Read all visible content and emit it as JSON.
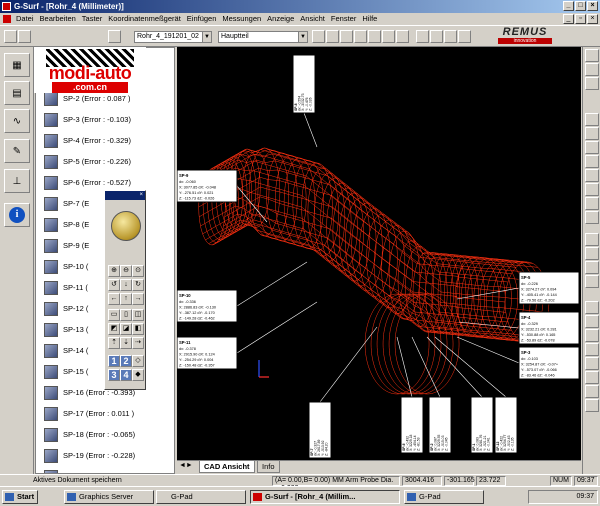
{
  "window": {
    "title": "G-Surf - [Rohr_4 (Millimeter)]"
  },
  "menu": [
    "Datei",
    "Bearbeiten",
    "Taster",
    "Koordinatenmeßgerät",
    "Einfügen",
    "Messungen",
    "Anzeige",
    "Ansicht",
    "Fenster",
    "Hilfe"
  ],
  "toolbar": {
    "file_combo": "Rohr_4_191201_02",
    "part_combo": "Hauptteil"
  },
  "brand": {
    "name": "REMUS",
    "tagline": "innovation"
  },
  "watermark": {
    "line1": "modi-auto",
    "line2": ".com.cn"
  },
  "tree": {
    "items": [
      "SP-1 (Error : 0.083 )",
      "SP-2 (Error : 0.087 )",
      "SP-3 (Error : -0.103)",
      "SP-4 (Error : -0.329)",
      "SP-5 (Error : -0.226)",
      "SP-6 (Error : -0.527)",
      "SP-7 (E",
      "SP-8 (E",
      "SP-9 (E",
      "SP-10 (",
      "SP-11 (",
      "SP-12 (",
      "SP-13 (",
      "SP-14 (",
      "SP-15 (",
      "SP-16 (Error : -0.393)",
      "SP-17 (Error : 0.011 )",
      "SP-18 (Error : -0.065)",
      "SP-19 (Error : -0.228)",
      "SP-20 (Error : -0.331)"
    ]
  },
  "palette": {
    "numbers": [
      "1",
      "2",
      "3",
      "4"
    ]
  },
  "viewport": {
    "callouts": [
      {
        "title": "SP-5",
        "lines": [
          "dx: -0.226",
          "X: 3274.27 dY: 0.094",
          "Y: -405.41 dY: -0.144",
          "Z: -79.56 dZ: -0.202"
        ]
      },
      {
        "title": "SP-4",
        "lines": [
          "dx: -0.329",
          "X: 3232.21 dX: 0.281",
          "Y: -530.88 dY: 0.165",
          "Z: -53.89 dZ: -0.078"
        ]
      },
      {
        "title": "SP-3",
        "lines": [
          "dx: -0.103",
          "X: 3254.87 dX: -0.07+",
          "Y: -573.07 dY: -0.066",
          "Z: -83.46 dZ: -0.046"
        ]
      },
      {
        "title": "SP-9",
        "lines": [
          "dx: -0.060",
          "X: 3077.85 dX: -0.048",
          "Y: -276.51 dY: 0.021",
          "Z: -115.73 dZ: -0.026"
        ]
      },
      {
        "title": "SP-10",
        "lines": [
          "dx: -0.336",
          "X: 2886.83 dX: -0.130",
          "Y: -387.12 dY: -0.170",
          "Z: -149.28 dZ: -0.462"
        ]
      },
      {
        "title": "SP-11",
        "lines": [
          "dx: -0.378",
          "X: 2915.90 dX: 0.124",
          "Y: -254.29 dY: 0.004",
          "Z: -150.48 dZ: -0.357"
        ]
      }
    ],
    "vertical_callouts": [
      {
        "title": "SP-8",
        "lines": [
          "dx: -0.554",
          "X: -3032.73",
          "Y: -0.476",
          "Z: -0.026"
        ]
      },
      {
        "title": "SP-7",
        "lines": [
          "dx: -0.327",
          "X: 2617.89",
          "Y: -513.92",
          "Z: -84.20"
        ]
      },
      {
        "title": "SP-6",
        "lines": [
          "dx: -0.432",
          "X: 3229.18",
          "Y: -454.14",
          "Z: -81.53"
        ]
      },
      {
        "title": "SP-2",
        "lines": [
          "dx: 0.087",
          "X: 3229.55",
          "Y: -515.03",
          "Z: -0.045"
        ]
      },
      {
        "title": "SP-1",
        "lines": [
          "dx: 0.083",
          "X: 3281.76",
          "Y: -521.21",
          "Z: -0.041"
        ]
      },
      {
        "title": "SP-12",
        "lines": [
          "dx: -0.422",
          "X: 3254.77",
          "Y: -502.43",
          "Z: -0.135"
        ]
      }
    ]
  },
  "tabs": {
    "active": "CAD Ansicht",
    "other": "Info"
  },
  "status": {
    "message": "Aktives Dokument speichern",
    "probe": "(A= 0.00,B= 0.00) MM Arm Probe Dia. = 6.000",
    "x": "3004.416",
    "y": "-301.165",
    "z": "23.722",
    "num": "NUM",
    "time": "09:37"
  },
  "taskbar": {
    "start": "Start",
    "tasks": [
      "Graphics Server",
      "G-Pad",
      "G-Surf - [Rohr_4 (Millim...",
      "G-Pad"
    ],
    "clock": "09:37"
  }
}
